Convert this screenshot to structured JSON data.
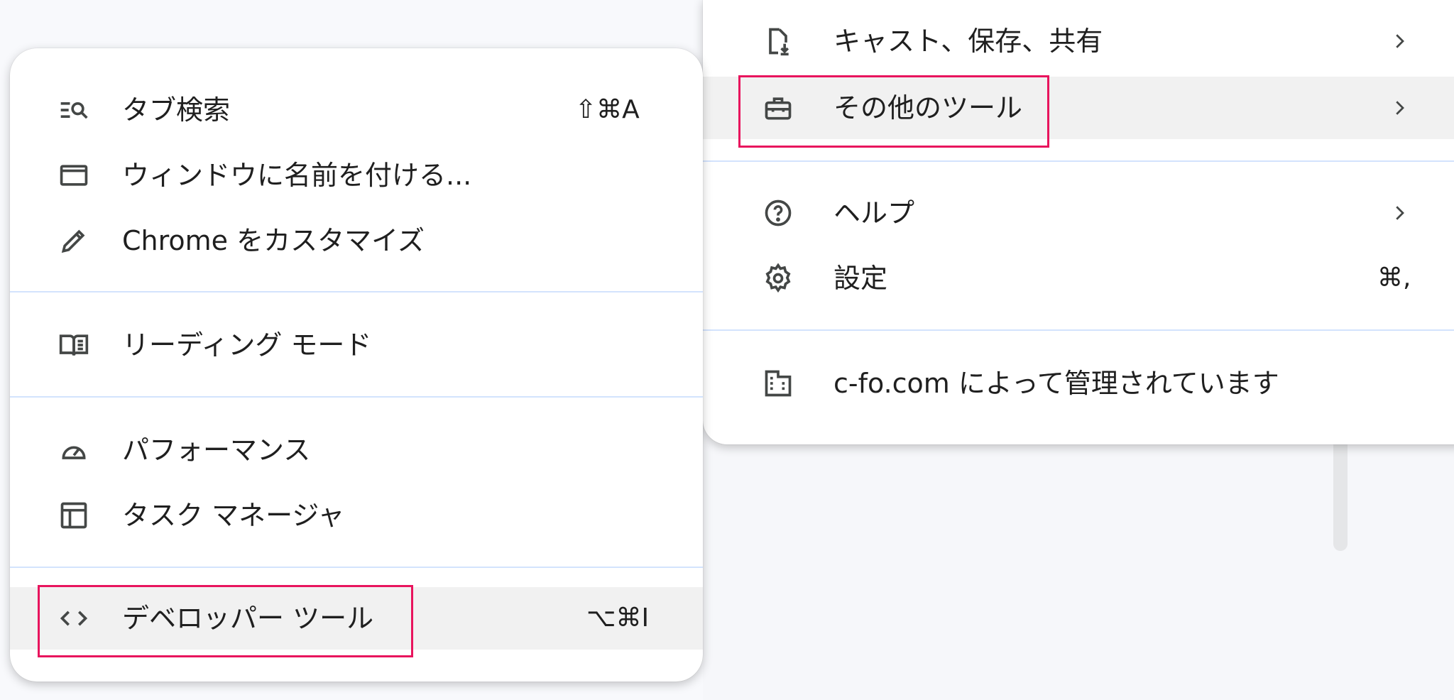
{
  "main_menu": {
    "items": [
      {
        "label": "キャスト、保存、共有",
        "icon": "cast-save-share-icon"
      },
      {
        "label": "その他のツール",
        "icon": "toolbox-icon"
      },
      {
        "label": "ヘルプ",
        "icon": "help-icon"
      },
      {
        "label": "設定",
        "shortcut": "⌘,",
        "icon": "gear-icon"
      },
      {
        "label": "c-fo.com によって管理されています",
        "icon": "building-icon"
      }
    ]
  },
  "sub_menu": {
    "items": [
      {
        "label": "タブ検索",
        "shortcut": "⇧⌘A",
        "icon": "tab-search-icon"
      },
      {
        "label": "ウィンドウに名前を付ける...",
        "icon": "window-icon"
      },
      {
        "label": "Chrome をカスタマイズ",
        "icon": "pencil-icon"
      },
      {
        "label": "リーディング モード",
        "icon": "book-icon"
      },
      {
        "label": "パフォーマンス",
        "icon": "speedometer-icon"
      },
      {
        "label": "タスク マネージャ",
        "icon": "task-manager-icon"
      },
      {
        "label": "デベロッパー ツール",
        "shortcut": "⌥⌘I",
        "icon": "code-icon"
      }
    ]
  },
  "colors": {
    "highlight_box": "#e8145d",
    "separator": "#d3e3fd",
    "hover_row": "#f1f1f1",
    "icon": "#444746"
  }
}
